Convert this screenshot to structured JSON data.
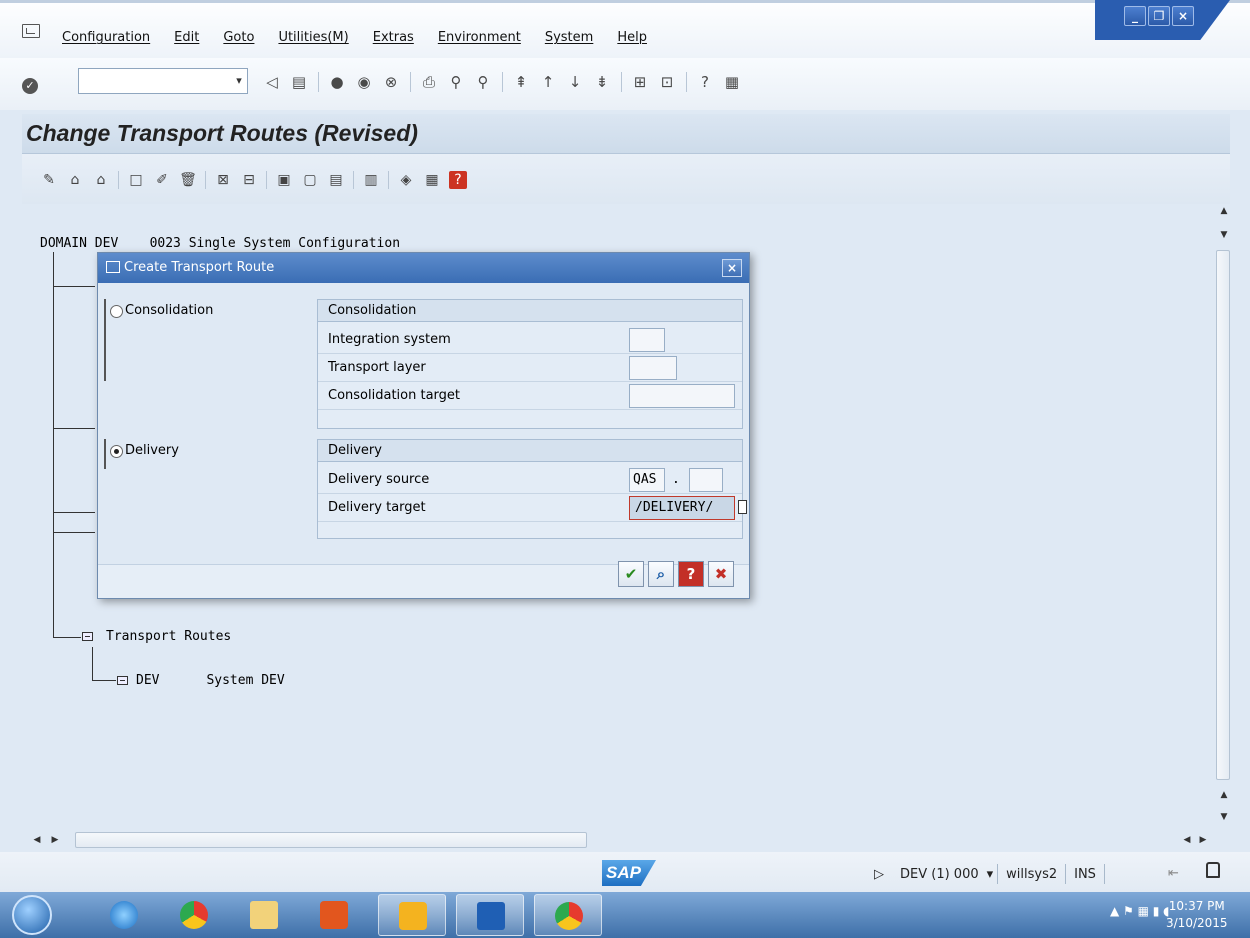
{
  "menu": {
    "items": [
      "Configuration",
      "Edit",
      "Goto",
      "Utilities(M)",
      "Extras",
      "Environment",
      "System",
      "Help"
    ]
  },
  "window_controls": {
    "minimize": "_",
    "restore": "❐",
    "close": "×"
  },
  "toolbar": {
    "command_field_value": "",
    "dropdown": "▾"
  },
  "page": {
    "title": "Change Transport Routes (Revised)"
  },
  "tree": {
    "domain_line": "DOMAIN DEV    0023 Single System Configuration",
    "transport_routes": "Transport Routes",
    "dev_node": "DEV      System DEV"
  },
  "dialog": {
    "title": "Create Transport Route",
    "close_label": "×",
    "radio_consolidation": "Consolidation",
    "radio_delivery": "Delivery",
    "consolidation_group": {
      "header": "Consolidation",
      "integration_system": "Integration system",
      "transport_layer": "Transport layer",
      "consolidation_target": "Consolidation target"
    },
    "delivery_group": {
      "header": "Delivery",
      "delivery_source_label": "Delivery source",
      "delivery_source_value": "QAS",
      "delivery_source_sep": ".",
      "delivery_target_label": "Delivery target",
      "delivery_target_value": "/DELIVERY/"
    },
    "buttons": {
      "ok": "✔",
      "find": "⌕",
      "help": "?",
      "cancel": "✖"
    },
    "selected_route_type": "Delivery"
  },
  "status": {
    "sap_logo": "SAP",
    "system": "DEV (1) 000",
    "user": "willsys2",
    "mode": "INS"
  },
  "taskbar": {
    "time": "10:37 PM",
    "date": "3/10/2015"
  },
  "colors": {
    "title_blue": "#3a6db4",
    "sap_blue": "#1e6fc2",
    "taskbar": "#3e6fa8"
  }
}
